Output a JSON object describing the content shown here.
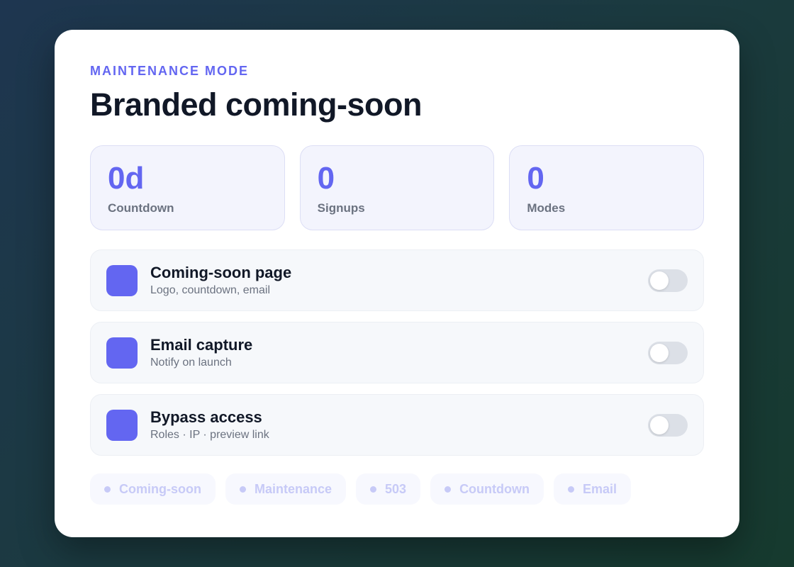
{
  "header": {
    "eyebrow": "MAINTENANCE MODE",
    "title": "Branded coming-soon"
  },
  "stats": [
    {
      "value": "0d",
      "label": "Countdown"
    },
    {
      "value": "0",
      "label": "Signups"
    },
    {
      "value": "0",
      "label": "Modes"
    }
  ],
  "features": [
    {
      "title": "Coming-soon page",
      "subtitle": "Logo, countdown, email",
      "enabled": false
    },
    {
      "title": "Email capture",
      "subtitle": "Notify on launch",
      "enabled": false
    },
    {
      "title": "Bypass access",
      "subtitle": "Roles · IP · preview link",
      "enabled": false
    }
  ],
  "tags": [
    "Coming-soon",
    "Maintenance",
    "503",
    "Countdown",
    "Email"
  ],
  "colors": {
    "accent": "#6366f1",
    "toggle_off": "#dce0e7",
    "tag_text": "#c7caf7"
  }
}
